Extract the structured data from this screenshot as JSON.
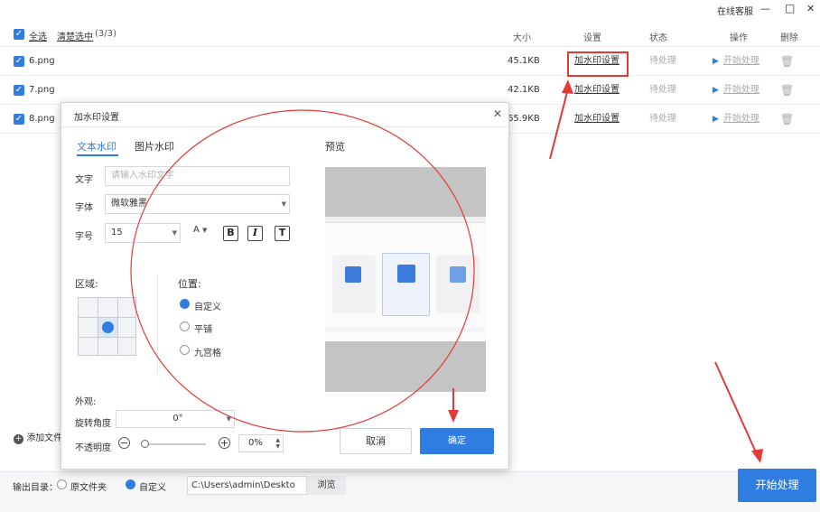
{
  "titlebar": {
    "service": "在线客服",
    "minimize": "—",
    "maximize": "□",
    "close": "✕"
  },
  "list": {
    "select_all": "全选",
    "clear_selected": "清楚选中",
    "count": "(3/3)",
    "columns": {
      "size": "大小",
      "settings": "设置",
      "status": "状态",
      "action": "操作",
      "delete": "删除"
    },
    "rows": [
      {
        "name": "6.png",
        "size": "45.1KB",
        "setting": "加水印设置",
        "status": "待处理",
        "action": "开始处理"
      },
      {
        "name": "7.png",
        "size": "42.1KB",
        "setting": "加水印设置",
        "status": "待处理",
        "action": "开始处理"
      },
      {
        "name": "8.png",
        "size": "65.9KB",
        "setting": "加水印设置",
        "status": "待处理",
        "action": "开始处理"
      }
    ],
    "add_file": "添加文件"
  },
  "output": {
    "label": "输出目录：",
    "opt_source": "原文件夹",
    "opt_custom": "自定义",
    "path": "C:\\Users\\admin\\Deskto",
    "browse": "浏览"
  },
  "start_button": "开始处理",
  "dialog": {
    "title": "加水印设置",
    "close": "✕",
    "tab_text": "文本水印",
    "tab_image": "图片水印",
    "text_label": "文字",
    "text_placeholder": "请输入水印文字",
    "font_label": "字体",
    "font_value": "微软雅黑",
    "size_label": "字号",
    "size_value": "15",
    "color_glyph": "A",
    "bold": "B",
    "italic": "I",
    "text_style": "T",
    "region_label": "区域:",
    "position_label": "位置:",
    "positions": [
      "自定义",
      "平铺",
      "九宫格"
    ],
    "appearance_label": "外观:",
    "rotation_label": "旋转角度",
    "rotation_value": "0°",
    "opacity_label": "不透明度",
    "opacity_value": "0%",
    "opacity_level": 0,
    "minus": "−",
    "plus": "+",
    "preview_label": "预览",
    "cancel": "取消",
    "confirm": "确定"
  },
  "colors": {
    "accent": "#2f7de1",
    "annotation": "#e53935"
  }
}
